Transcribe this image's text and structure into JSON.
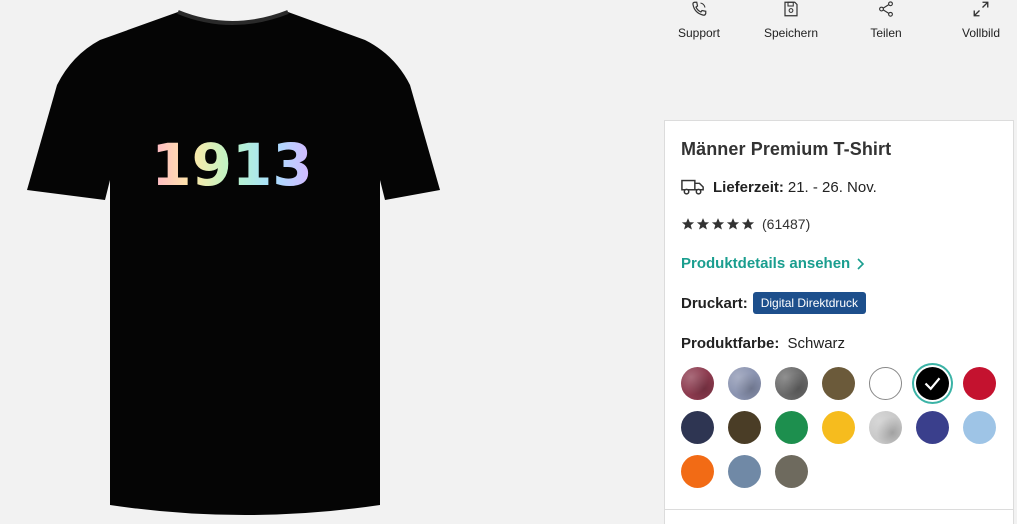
{
  "product_image": {
    "print_text": "1913",
    "shirt_color": "#050505"
  },
  "actions": [
    {
      "label": "Support",
      "icon": "phone-icon"
    },
    {
      "label": "Speichern",
      "icon": "save-icon"
    },
    {
      "label": "Teilen",
      "icon": "share-icon"
    },
    {
      "label": "Vollbild",
      "icon": "fullscreen-icon"
    }
  ],
  "product": {
    "title": "Männer Premium T-Shirt",
    "delivery_label": "Lieferzeit:",
    "delivery_value": "21. - 26. Nov.",
    "rating_count": "(61487)",
    "rating_stars": 5,
    "details_link": "Produktdetails ansehen",
    "print_label": "Druckart:",
    "print_badge": "Digital Direktdruck",
    "color_label": "Produktfarbe:",
    "color_value": "Schwarz"
  },
  "swatches": [
    {
      "color": "#8c3a4e",
      "textured": true,
      "selected": false
    },
    {
      "color": "#8a93b0",
      "textured": true,
      "selected": false
    },
    {
      "color": "#6a6a6a",
      "textured": true,
      "selected": false
    },
    {
      "color": "#6b5a3a",
      "textured": false,
      "selected": false
    },
    {
      "color": "#ffffff",
      "textured": false,
      "selected": false
    },
    {
      "color": "#000000",
      "textured": false,
      "selected": true
    },
    {
      "color": "#c4122f",
      "textured": false,
      "selected": false
    },
    {
      "color": "#2e3552",
      "textured": false,
      "selected": false
    },
    {
      "color": "#4a3d26",
      "textured": false,
      "selected": false
    },
    {
      "color": "#1d8f4e",
      "textured": false,
      "selected": false
    },
    {
      "color": "#f6bc1e",
      "textured": false,
      "selected": false
    },
    {
      "color": "#c9c9c9",
      "textured": true,
      "selected": false
    },
    {
      "color": "#3a3f8c",
      "textured": false,
      "selected": false
    },
    {
      "color": "#9ec4e6",
      "textured": false,
      "selected": false
    },
    {
      "color": "#f26b15",
      "textured": false,
      "selected": false
    },
    {
      "color": "#7089a6",
      "textured": false,
      "selected": false
    },
    {
      "color": "#6e6a5e",
      "textured": false,
      "selected": false
    }
  ],
  "colors": {
    "accent": "#1a9e8f",
    "badge": "#1d4f8c",
    "selected_ring": "#3bb3a6"
  }
}
